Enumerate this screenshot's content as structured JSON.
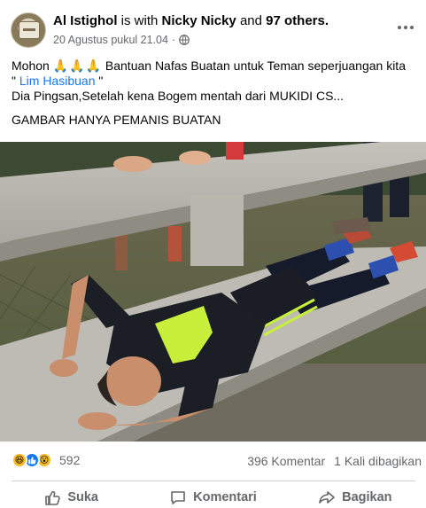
{
  "post": {
    "author": "Al Istighol",
    "with_text": "is with",
    "tagged_name": "Nicky Nicky",
    "and_text": "and",
    "others": "97 others.",
    "timestamp": "20 Agustus pukul 21.04",
    "privacy_separator": "·",
    "privacy_icon": "globe-icon",
    "text_line1": "Mohon",
    "pray_emoji": "🙏🙏🙏",
    "text_line1_rest": "Bantuan Nafas Buatan untuk Teman seperjuangan kita",
    "text_line2_prefix": "\"",
    "mention": "Lim Hasibuan",
    "text_line2_suffix": "\"",
    "text_line3": "Dia Pingsan,Setelah kena Bogem mentah dari MUKIDI CS...",
    "text_line4": "GAMBAR HANYA PEMANIS BUATAN"
  },
  "stats": {
    "reactions": [
      "haha",
      "like",
      "wow"
    ],
    "reaction_count": "592",
    "comments": "396 Komentar",
    "shares": "1 Kali dibagikan"
  },
  "actions": {
    "like_label": "Suka",
    "comment_label": "Komentari",
    "share_label": "Bagikan"
  },
  "colors": {
    "link": "#1877f2",
    "meta_text": "#65676b",
    "jersey_accent": "#c8ef3a"
  }
}
